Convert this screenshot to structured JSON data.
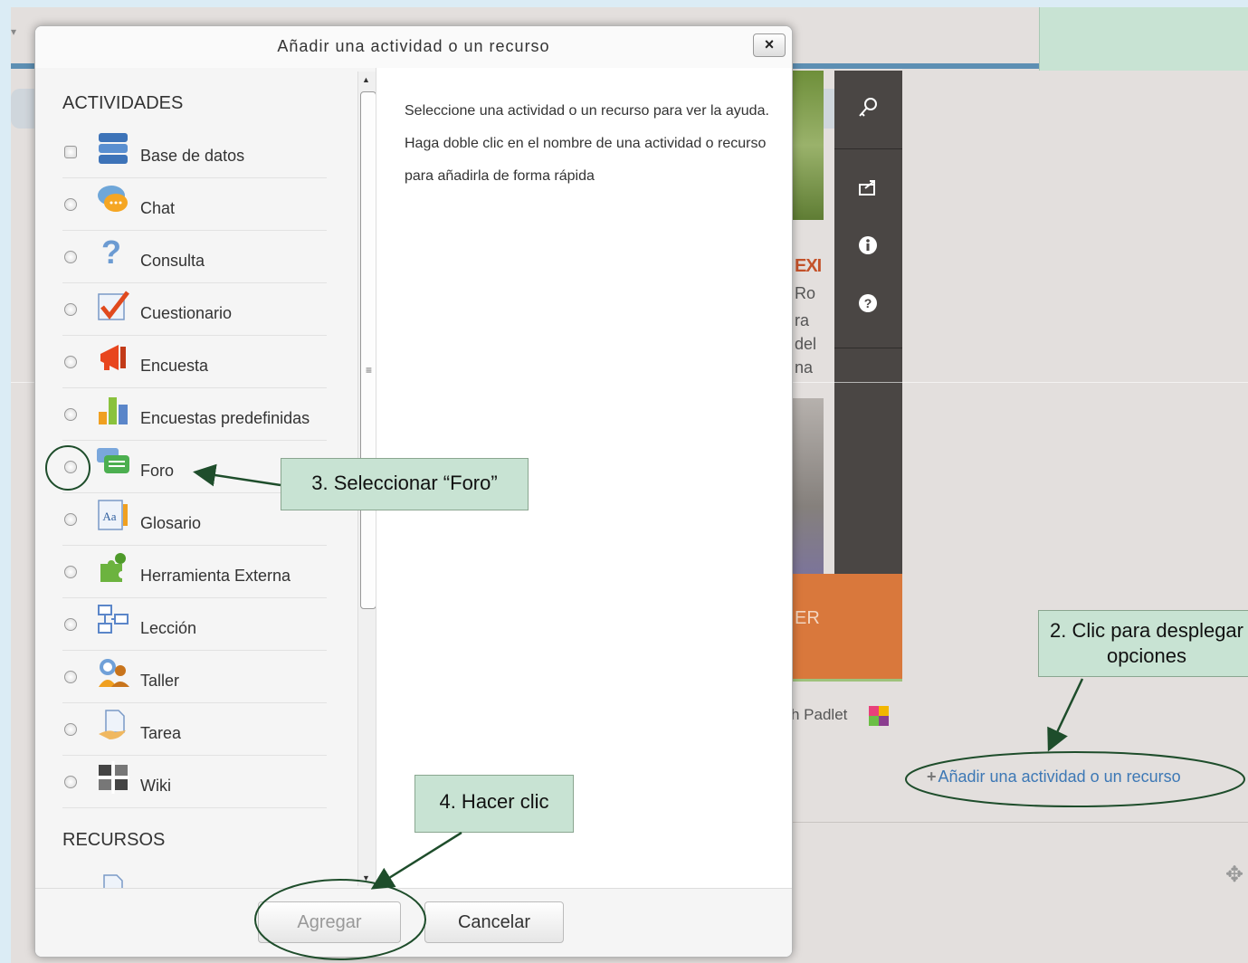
{
  "background": {
    "orange_label": "ER",
    "fragment_expr": "EXI",
    "fragments": [
      "Ro",
      "ra",
      "del",
      "na"
    ],
    "padlet_text": "h Padlet",
    "add_link": "Añadir una actividad o un recurso",
    "sidebar_icons": [
      "key-icon",
      "share-icon",
      "info-icon",
      "help-icon"
    ]
  },
  "dialog": {
    "title": "Añadir una actividad o un recurso",
    "close_label": "×",
    "sections": [
      {
        "title": "ACTIVIDADES"
      },
      {
        "title": "RECURSOS"
      }
    ],
    "activities": [
      {
        "label": "Base de datos",
        "icon": "database-icon"
      },
      {
        "label": "Chat",
        "icon": "chat-icon"
      },
      {
        "label": "Consulta",
        "icon": "question-icon"
      },
      {
        "label": "Cuestionario",
        "icon": "quiz-icon"
      },
      {
        "label": "Encuesta",
        "icon": "megaphone-icon"
      },
      {
        "label": "Encuestas predefinidas",
        "icon": "bar-chart-icon"
      },
      {
        "label": "Foro",
        "icon": "forum-icon"
      },
      {
        "label": "Glosario",
        "icon": "glossary-icon"
      },
      {
        "label": "Herramienta Externa",
        "icon": "puzzle-icon"
      },
      {
        "label": "Lección",
        "icon": "lesson-icon"
      },
      {
        "label": "Taller",
        "icon": "workshop-icon"
      },
      {
        "label": "Tarea",
        "icon": "assignment-icon"
      },
      {
        "label": "Wiki",
        "icon": "wiki-icon"
      }
    ],
    "help_text": "Seleccione una actividad o un recurso para ver la ayuda. Haga doble clic en el nombre de una actividad o recurso para añadirla de forma rápida",
    "buttons": {
      "add": "Agregar",
      "cancel": "Cancelar"
    }
  },
  "annotations": {
    "step2": "2. Clic para desplegar opciones",
    "step3": "3. Seleccionar “Foro”",
    "step4": "4. Hacer clic"
  },
  "colors": {
    "annotation_green": "#1e4d2b",
    "callout_bg": "#c8e3d3",
    "link_blue": "#3d78b5",
    "orange": "#d9783c"
  }
}
